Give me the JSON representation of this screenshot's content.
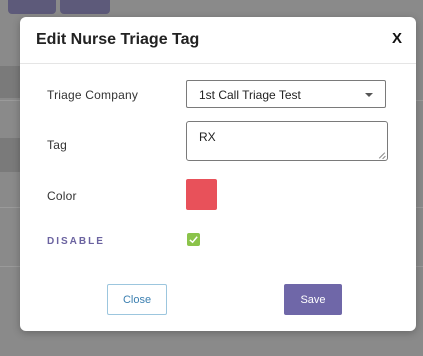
{
  "modal": {
    "title": "Edit Nurse Triage Tag",
    "close_glyph": "X"
  },
  "form": {
    "company_label": "Triage Company",
    "company_value": "1st Call Triage Test",
    "tag_label": "Tag",
    "tag_value": "RX",
    "color_label": "Color",
    "color_value": "#e8515a",
    "disable_label": "DISABLE",
    "disable_checked": true
  },
  "buttons": {
    "close_label": "Close",
    "save_label": "Save"
  },
  "colors": {
    "accent": "#6f67a8",
    "checkbox": "#8bc34a",
    "close_border": "#9cc6de"
  },
  "icons": {
    "dropdown": "chevron-down-icon",
    "checkbox": "check-icon"
  }
}
